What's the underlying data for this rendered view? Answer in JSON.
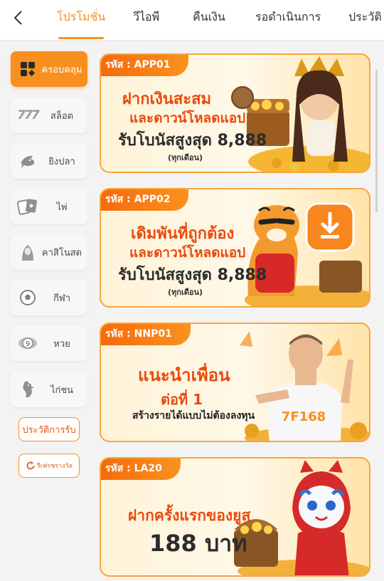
{
  "header": {
    "tabs": [
      {
        "label": "โปรโมชั่น",
        "active": true
      },
      {
        "label": "วีไอพี",
        "active": false
      },
      {
        "label": "คืนเงิน",
        "active": false
      },
      {
        "label": "รอดำเนินการ",
        "active": false
      },
      {
        "label": "ประวัติ",
        "active": false
      }
    ]
  },
  "sidebar": {
    "items": [
      {
        "label": "ครอบคลุม",
        "icon": "grid-icon",
        "active": true
      },
      {
        "label": "สล็อต",
        "icon": "slot-777-icon",
        "active": false
      },
      {
        "label": "ยิงปลา",
        "icon": "fish-icon",
        "active": false
      },
      {
        "label": "ไพ่",
        "icon": "cards-icon",
        "active": false
      },
      {
        "label": "คาสิโนสด",
        "icon": "dealer-icon",
        "active": false
      },
      {
        "label": "กีฬา",
        "icon": "soccer-ball-icon",
        "active": false
      },
      {
        "label": "หวย",
        "icon": "lottery-ball-icon",
        "active": false
      },
      {
        "label": "ไก่ชน",
        "icon": "rooster-icon",
        "active": false
      }
    ],
    "history_label": "ประวัติการรับ",
    "refresh_label": "รีเฟรชรางวัล"
  },
  "promos": [
    {
      "code": "รหัส : APP01",
      "line1": "ฝากเงินสะสม",
      "line2": "และดาวน์โหลดแอป",
      "line3": "รับโบนัสสูงสุด 8,888",
      "line4": "(ทุกเดือน)",
      "art": "goddess-treasure-chest"
    },
    {
      "code": "รหัส : APP02",
      "line1": "เดิมพันที่ถูกต้อง",
      "line2": "และดาวน์โหลดแอป",
      "line3": "รับโบนัสสูงสุด 8,888",
      "line4": "(ทุกเดือน)",
      "art": "tiger-download"
    },
    {
      "code": "รหัส : NNP01",
      "line1": "แนะนำเพื่อน",
      "line2": "ต่อที่ 1",
      "line3": "สร้างรายได้แบบไม่ต้องลงทุน",
      "line4": "",
      "art": "man-pointing-jersey",
      "jersey_text": "7F168"
    },
    {
      "code": "รหัส : LA20",
      "line1": "ฝากครั้งแรกของยูส",
      "line2": "188 บาท",
      "line3": "",
      "line4": "",
      "art": "cat-treasure-chest"
    }
  ],
  "colors": {
    "accent": "#f7901e",
    "promo_red": "#ea4a0c",
    "tab_text": "#333333"
  }
}
